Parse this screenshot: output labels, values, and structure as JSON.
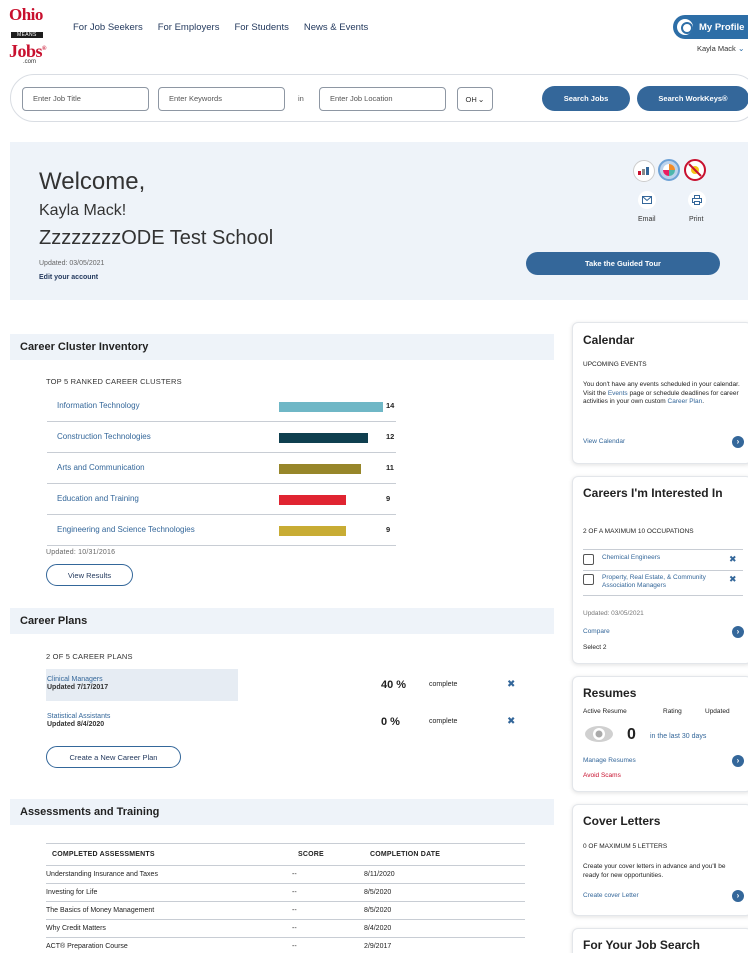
{
  "logo": {
    "line1": "Ohio",
    "line2": "MEANS",
    "line3": "Jobs",
    "line4": ".com"
  },
  "nav": [
    "For Job Seekers",
    "For Employers",
    "For Students",
    "News & Events"
  ],
  "profile": {
    "button": "My Profile",
    "user": "Kayla Mack"
  },
  "search": {
    "job_title_placeholder": "Enter Job Title",
    "keywords_placeholder": "Enter Keywords",
    "in_label": "in",
    "location_placeholder": "Enter Job Location",
    "state": "OH",
    "search_jobs": "Search Jobs",
    "search_workkeys": "Search WorkKeys®"
  },
  "welcome": {
    "greeting": "Welcome,",
    "name": "Kayla Mack!",
    "school": "ZzzzzzzzODE Test School",
    "updated": "Updated: 03/05/2021",
    "edit": "Edit your account",
    "email": "Email",
    "print": "Print",
    "tour": "Take the Guided Tour"
  },
  "career_cluster": {
    "title": "Career Cluster Inventory",
    "subtitle": "TOP 5 RANKED CAREER CLUSTERS",
    "updated": "Updated: 10/31/2016",
    "button": "View Results",
    "clusters": [
      {
        "label": "Information Technology",
        "value": 14,
        "color": "#6fb7c6"
      },
      {
        "label": "Construction Technologies",
        "value": 12,
        "color": "#0f3f4f"
      },
      {
        "label": "Arts and Communication",
        "value": 11,
        "color": "#97862a"
      },
      {
        "label": "Education and Training",
        "value": 9,
        "color": "#e02431"
      },
      {
        "label": "Engineering and Science Technologies",
        "value": 9,
        "color": "#c8ac34"
      }
    ]
  },
  "career_plans": {
    "title": "Career Plans",
    "subtitle": "2 OF 5 CAREER PLANS",
    "plans": [
      {
        "name": "Clinical Managers",
        "updated": "Updated 7/17/2017",
        "pct": "40 %",
        "complete": "complete"
      },
      {
        "name": "Statistical Assistants",
        "updated": "Updated 8/4/2020",
        "pct": "0 %",
        "complete": "complete"
      }
    ],
    "button": "Create a New Career Plan"
  },
  "assessments": {
    "title": "Assessments and Training",
    "headers": [
      "COMPLETED ASSESSMENTS",
      "SCORE",
      "COMPLETION DATE"
    ],
    "rows": [
      [
        "Understanding Insurance and Taxes",
        "--",
        "8/11/2020"
      ],
      [
        "Investing for Life",
        "--",
        "8/5/2020"
      ],
      [
        "The Basics of Money Management",
        "--",
        "8/5/2020"
      ],
      [
        "Why Credit Matters",
        "--",
        "8/4/2020"
      ],
      [
        "ACT® Preparation Course",
        "--",
        "2/9/2017"
      ]
    ]
  },
  "calendar": {
    "title": "Calendar",
    "caption": "UPCOMING EVENTS",
    "text1": "You don't have any events scheduled in your calendar. Visit the ",
    "events_link": "Events",
    "text2": " page or schedule deadlines for career activities in your own custom ",
    "plan_link": "Career Plan",
    "text3": ".",
    "link": "View Calendar"
  },
  "careers": {
    "title": "Careers I'm Interested In",
    "caption": "2 OF A MAXIMUM 10 OCCUPATIONS",
    "items": [
      "Chemical Engineers",
      "Property, Real Estate, & Community Association Managers"
    ],
    "updated": "Updated: 03/05/2021",
    "compare": "Compare",
    "select": "Select 2"
  },
  "resumes": {
    "title": "Resumes",
    "cols": [
      "Active Resume",
      "Rating",
      "Updated"
    ],
    "count": "0",
    "period": "in the last 30 days",
    "manage": "Manage Resumes",
    "scams": "Avoid Scams"
  },
  "cover_letters": {
    "title": "Cover Letters",
    "caption": "0 OF MAXIMUM 5 LETTERS",
    "text": "Create your cover letters in advance and you'll be ready for new opportunities.",
    "link": "Create cover Letter"
  },
  "job_search": {
    "title": "For Your Job Search"
  }
}
